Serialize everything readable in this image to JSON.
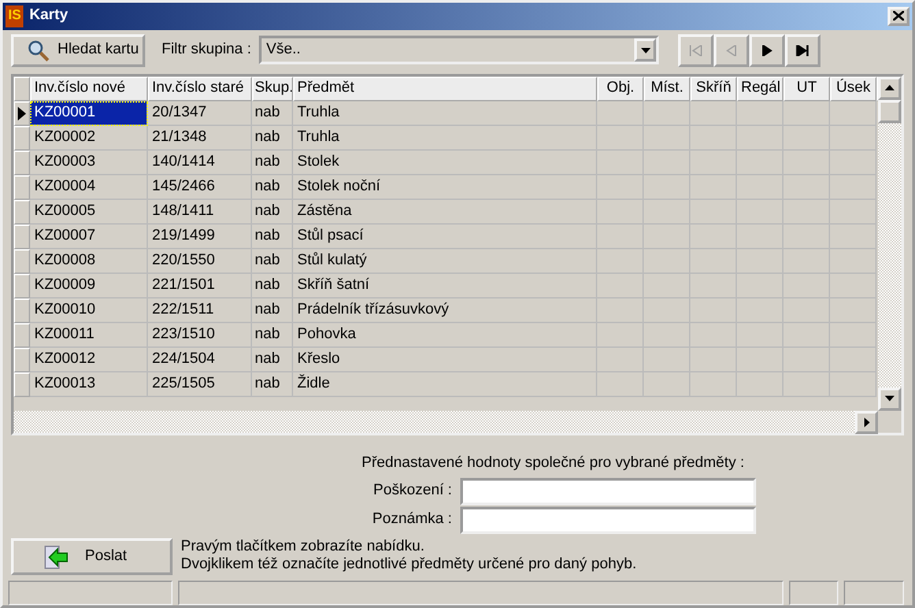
{
  "window": {
    "logo": "IS",
    "title": "Karty"
  },
  "toolbar": {
    "search_button": "Hledat kartu",
    "filter_label": "Filtr skupina :",
    "filter_value": "Vše..",
    "nav_buttons": [
      {
        "kind": "first",
        "disabled": true
      },
      {
        "kind": "prev",
        "disabled": true
      },
      {
        "kind": "next",
        "disabled": false
      },
      {
        "kind": "last",
        "disabled": false
      }
    ]
  },
  "table": {
    "columns": [
      "Inv.číslo nové",
      "Inv.číslo staré",
      "Skup.",
      "Předmět",
      "Obj.",
      "Míst.",
      "Skříň",
      "Regál",
      "UT",
      "Úsek"
    ],
    "rows": [
      {
        "cells": [
          "KZ00001",
          "20/1347",
          "nab",
          "Truhla"
        ],
        "selected": true
      },
      {
        "cells": [
          "KZ00002",
          "21/1348",
          "nab",
          "Truhla"
        ],
        "selected": false
      },
      {
        "cells": [
          "KZ00003",
          "140/1414",
          "nab",
          "Stolek"
        ],
        "selected": false
      },
      {
        "cells": [
          "KZ00004",
          "145/2466",
          "nab",
          "Stolek noční"
        ],
        "selected": false
      },
      {
        "cells": [
          "KZ00005",
          "148/1411",
          "nab",
          "Zástěna"
        ],
        "selected": false
      },
      {
        "cells": [
          "KZ00007",
          "219/1499",
          "nab",
          "Stůl psací"
        ],
        "selected": false
      },
      {
        "cells": [
          "KZ00008",
          "220/1550",
          "nab",
          "Stůl kulatý"
        ],
        "selected": false
      },
      {
        "cells": [
          "KZ00009",
          "221/1501",
          "nab",
          "Skříň šatní"
        ],
        "selected": false
      },
      {
        "cells": [
          "KZ00010",
          "222/1511",
          "nab",
          "Prádelník třízásuvkový"
        ],
        "selected": false
      },
      {
        "cells": [
          "KZ00011",
          "223/1510",
          "nab",
          "Pohovka"
        ],
        "selected": false
      },
      {
        "cells": [
          "KZ00012",
          "224/1504",
          "nab",
          "Křeslo"
        ],
        "selected": false
      },
      {
        "cells": [
          "KZ00013",
          "225/1505",
          "nab",
          "Židle"
        ],
        "selected": false
      }
    ]
  },
  "defaults": {
    "heading": "Přednastavené hodnoty společné pro vybrané předměty :",
    "fields": [
      {
        "label": "Poškození :"
      },
      {
        "label": "Poznámka :"
      }
    ]
  },
  "send_button": "Poslat",
  "hint_lines": [
    "Pravým tlačítkem zobrazíte nabídku.",
    "Dvojklikem též označíte jednotlivé předměty určené pro daný pohyb."
  ]
}
